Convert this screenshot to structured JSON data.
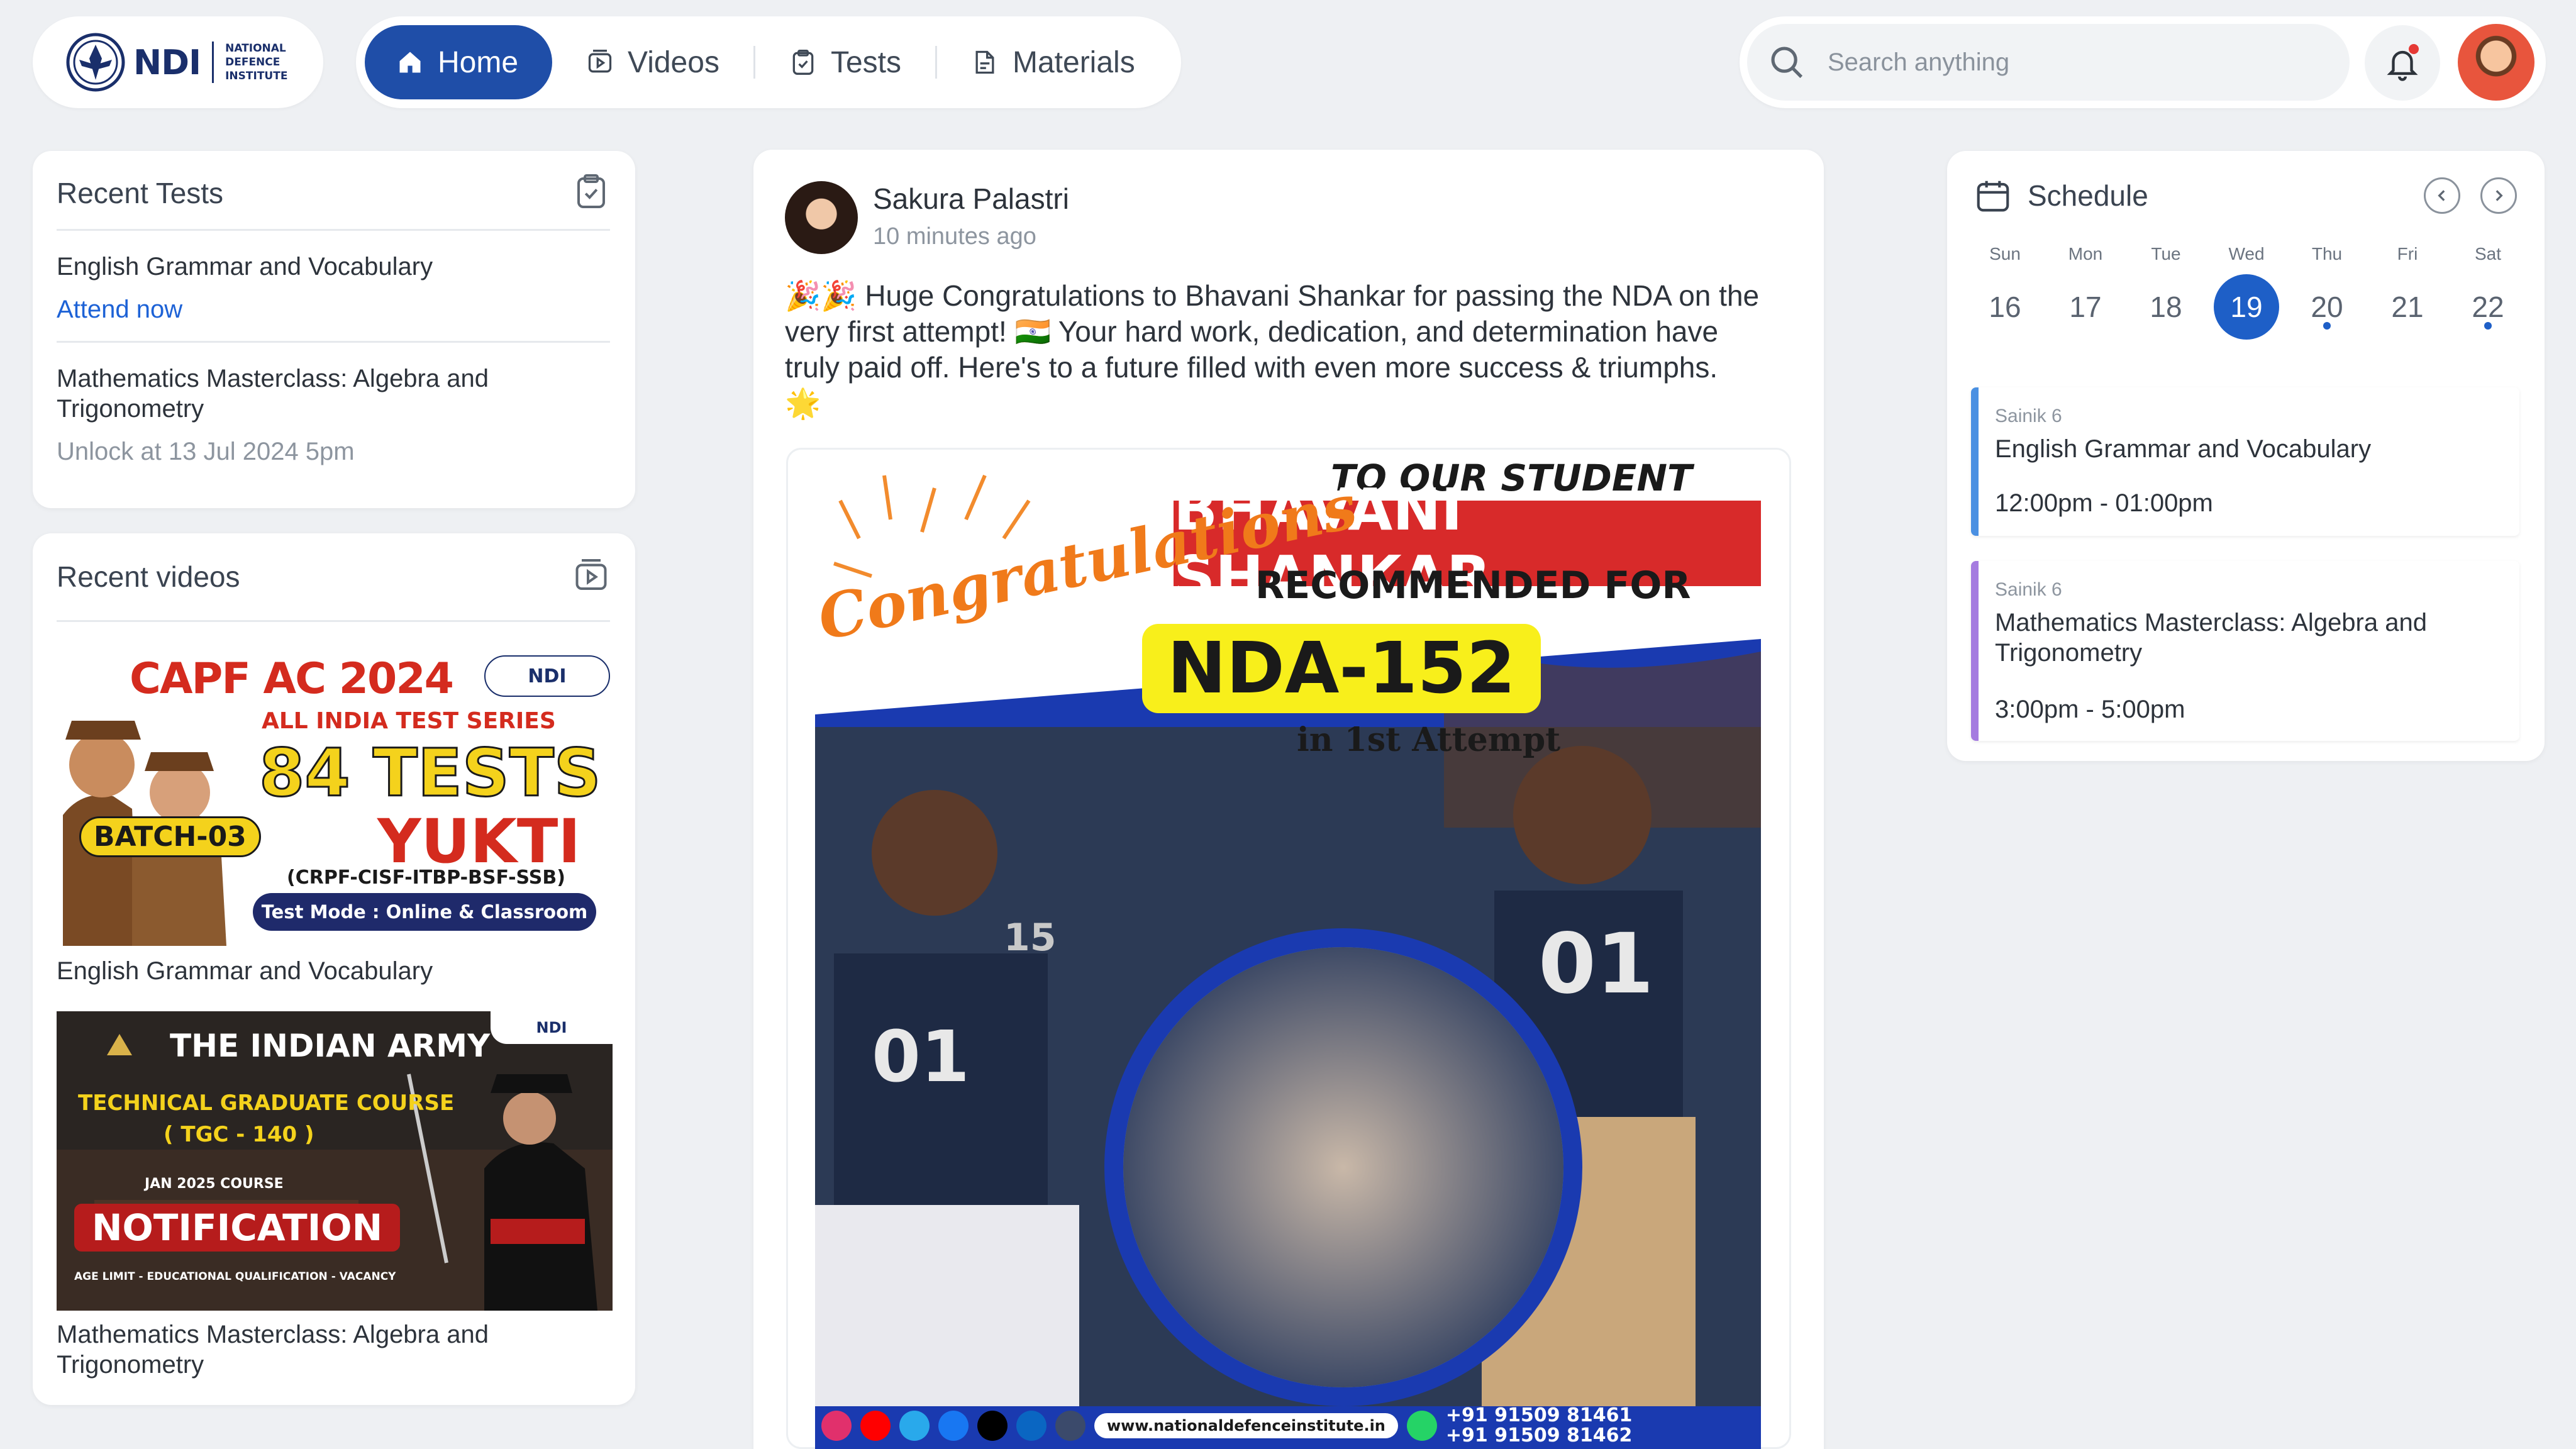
{
  "brand": {
    "logo_text": "NDI",
    "sub_line1": "NATIONAL",
    "sub_line2": "DEFENCE",
    "sub_line3": "INSTITUTE"
  },
  "nav": {
    "items": [
      {
        "label": "Home",
        "icon": "home-icon",
        "active": true
      },
      {
        "label": "Videos",
        "icon": "video-icon",
        "active": false
      },
      {
        "label": "Tests",
        "icon": "clipboard-icon",
        "active": false
      },
      {
        "label": "Materials",
        "icon": "document-icon",
        "active": false
      }
    ]
  },
  "search": {
    "placeholder": "Search anything"
  },
  "colors": {
    "primary": "#1f4ea8",
    "link": "#1d62d6",
    "event_blue": "#4a90e2",
    "event_purple": "#a57be0",
    "background": "#eef0f3"
  },
  "recent_tests": {
    "title": "Recent Tests",
    "items": [
      {
        "name": "English Grammar and Vocabulary",
        "action": "Attend now"
      },
      {
        "name_line1": "Mathematics Masterclass: Algebra and",
        "name_line2": "Trigonometry",
        "status": "Unlock at 13 Jul 2024 5pm"
      }
    ]
  },
  "recent_videos": {
    "title": "Recent videos",
    "items": [
      {
        "caption": "English Grammar and Vocabulary",
        "thumb": {
          "headline": "CAPF AC 2024",
          "line2": "ALL INDIA TEST SERIES",
          "big": "84 TESTS",
          "name": "YUKTI",
          "batch": "BATCH-03",
          "forces": "(CRPF-CISF-ITBP-BSF-SSB)",
          "mode": "Test Mode : Online & Classroom",
          "logo": "NDI"
        }
      },
      {
        "caption_line1": "Mathematics Masterclass: Algebra and",
        "caption_line2": "Trigonometry",
        "thumb": {
          "headline": "THE INDIAN ARMY",
          "line2": "TECHNICAL GRADUATE COURSE",
          "line3": "( TGC - 140 )",
          "line4": "JAN 2025 COURSE",
          "big": "NOTIFICATION",
          "footer": "AGE LIMIT - EDUCATIONAL QUALIFICATION - VACANCY",
          "logo": "NDI"
        }
      }
    ]
  },
  "post": {
    "author": "Sakura Palastri",
    "time": "10 minutes ago",
    "text_line1": "🎉🎉 Huge Congratulations to Bhavani Shankar for passing the NDA on the",
    "text_line2": "very first attempt! 🇮🇳 Your hard work, dedication, and determination have",
    "text_line3": "truly paid off. Here's to a future filled with even more success & triumphs.",
    "text_line4": "🌟",
    "poster": {
      "to_student": "TO OUR STUDENT",
      "script": "Congratulations",
      "name": "BHAVANI SHANKAR",
      "recommended": "RECOMMENDED FOR",
      "exam": "NDA-152",
      "attempt": "in 1st Attempt",
      "jersey1": "01",
      "jersey2": "01",
      "jersey3": "15",
      "website": "www.nationaldefenceinstitute.in",
      "phone1": "+91 91509 81461",
      "phone2": "+91 91509 81462"
    }
  },
  "schedule": {
    "title": "Schedule",
    "days": [
      {
        "dow": "Sun",
        "date": "16",
        "selected": false,
        "dot": false
      },
      {
        "dow": "Mon",
        "date": "17",
        "selected": false,
        "dot": false
      },
      {
        "dow": "Tue",
        "date": "18",
        "selected": false,
        "dot": false
      },
      {
        "dow": "Wed",
        "date": "19",
        "selected": true,
        "dot": false
      },
      {
        "dow": "Thu",
        "date": "20",
        "selected": false,
        "dot": true
      },
      {
        "dow": "Fri",
        "date": "21",
        "selected": false,
        "dot": false
      },
      {
        "dow": "Sat",
        "date": "22",
        "selected": false,
        "dot": true
      }
    ],
    "events": [
      {
        "group": "Sainik 6",
        "title": "English Grammar and Vocabulary",
        "time": "12:00pm - 01:00pm"
      },
      {
        "group": "Sainik 6",
        "title_line1": "Mathematics Masterclass: Algebra and",
        "title_line2": "Trigonometry",
        "time": "3:00pm - 5:00pm"
      }
    ]
  }
}
